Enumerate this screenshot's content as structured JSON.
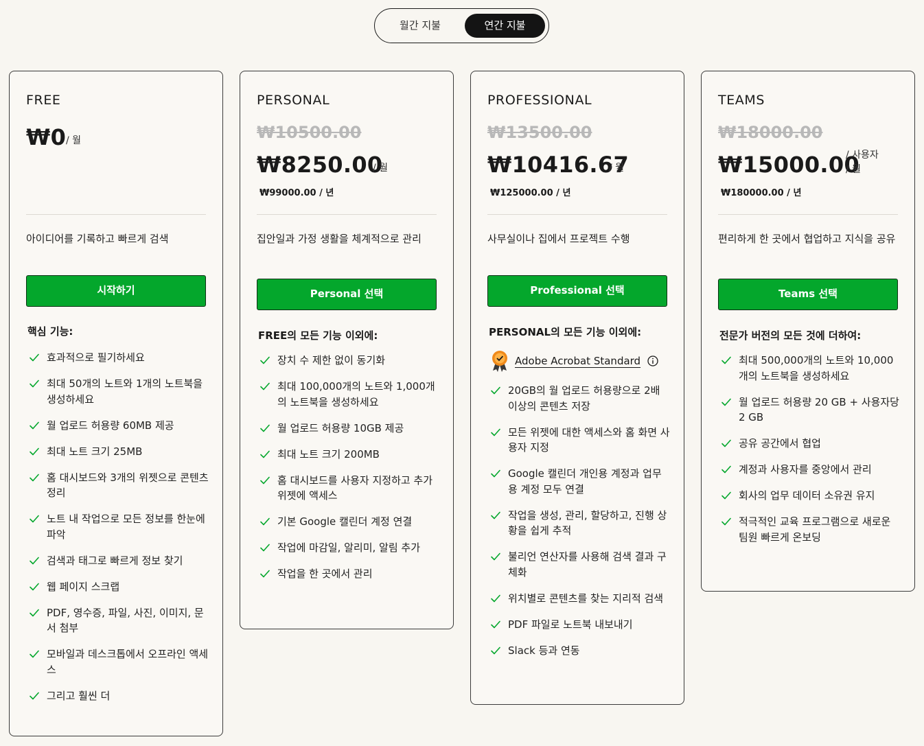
{
  "billing_toggle": {
    "monthly": "월간 지불",
    "annual": "연간 지불",
    "selected": "annual"
  },
  "brand_color": "#04a72c",
  "plans": [
    {
      "name": "FREE",
      "price": "₩0",
      "per": "/ 월",
      "description": "아이디어를 기록하고 빠르게 검색",
      "cta": "시작하기",
      "features_heading": "핵심 기능:",
      "features": [
        "효과적으로 필기하세요",
        "최대 50개의 노트와 1개의 노트북을 생성하세요",
        "월 업로드 허용량 60MB 제공",
        "최대 노트 크기 25MB",
        "홈 대시보드와 3개의 위젯으로 콘텐츠 정리",
        "노트 내 작업으로 모든 정보를 한눈에 파악",
        "검색과 태그로 빠르게 정보 찾기",
        "웹 페이지 스크랩",
        "PDF, 영수증, 파일, 사진, 이미지, 문서 첨부",
        "모바일과 데스크톱에서 오프라인 액세스",
        "그리고 훨씬 더"
      ]
    },
    {
      "name": "PERSONAL",
      "old_price": "₩10500.00",
      "price": "₩8250.00",
      "per": "/ 월",
      "annual_total": "₩99000.00 / 년",
      "description": "집안일과 가정 생활을 체계적으로 관리",
      "cta": "Personal 선택",
      "features_heading": "FREE의 모든 기능 이외에:",
      "features": [
        "장치 수 제한 없이 동기화",
        "최대 100,000개의 노트와 1,000개의 노트북을 생성하세요",
        "월 업로드 허용량 10GB 제공",
        "최대 노트 크기 200MB",
        "홈 대시보드를 사용자 지정하고 추가 위젯에 액세스",
        "기본 Google 캘린더 계정 연결",
        "작업에 마감일, 알리미, 알림 추가",
        "작업을 한 곳에서 관리"
      ]
    },
    {
      "name": "PROFESSIONAL",
      "old_price": "₩13500.00",
      "price": "₩10416.67",
      "per": "/ 월",
      "annual_total": "₩125000.00 / 년",
      "description": "사무실이나 집에서 프로젝트 수행",
      "cta": "Professional 선택",
      "features_heading": "PERSONAL의 모든 기능 이외에:",
      "badge": {
        "label": "Adobe Acrobat Standard",
        "icon": "award-badge-icon"
      },
      "features": [
        "20GB의 월 업로드 허용량으로 2배 이상의 콘텐츠 저장",
        "모든 위젯에 대한 액세스와 홈 화면 사용자 지정",
        "Google 캘린더 개인용 계정과 업무용 계정 모두 연결",
        "작업을 생성, 관리, 할당하고, 진행 상황을 쉽게 추적",
        "불리언 연산자를 사용해 검색 결과 구체화",
        "위치별로 콘텐츠를 찾는 지리적 검색",
        "PDF 파일로 노트북 내보내기",
        "Slack 등과 연동"
      ]
    },
    {
      "name": "TEAMS",
      "old_price": "₩18000.00",
      "price": "₩15000.00",
      "per_user": "/ 사용자",
      "per": "/ 월",
      "annual_total": "₩180000.00 / 년",
      "description": "편리하게 한 곳에서 협업하고 지식을 공유",
      "cta": "Teams 선택",
      "features_heading": "전문가 버전의 모든 것에 더하여:",
      "features": [
        "최대 500,000개의 노트와 10,000개의 노트북을 생성하세요",
        "월 업로드 허용량 20 GB + 사용자당 2 GB",
        "공유 공간에서 협업",
        "계정과 사용자를 중앙에서 관리",
        "회사의 업무 데이터 소유권 유지",
        "적극적인 교육 프로그램으로 새로운 팀원 빠르게 온보딩"
      ]
    }
  ]
}
